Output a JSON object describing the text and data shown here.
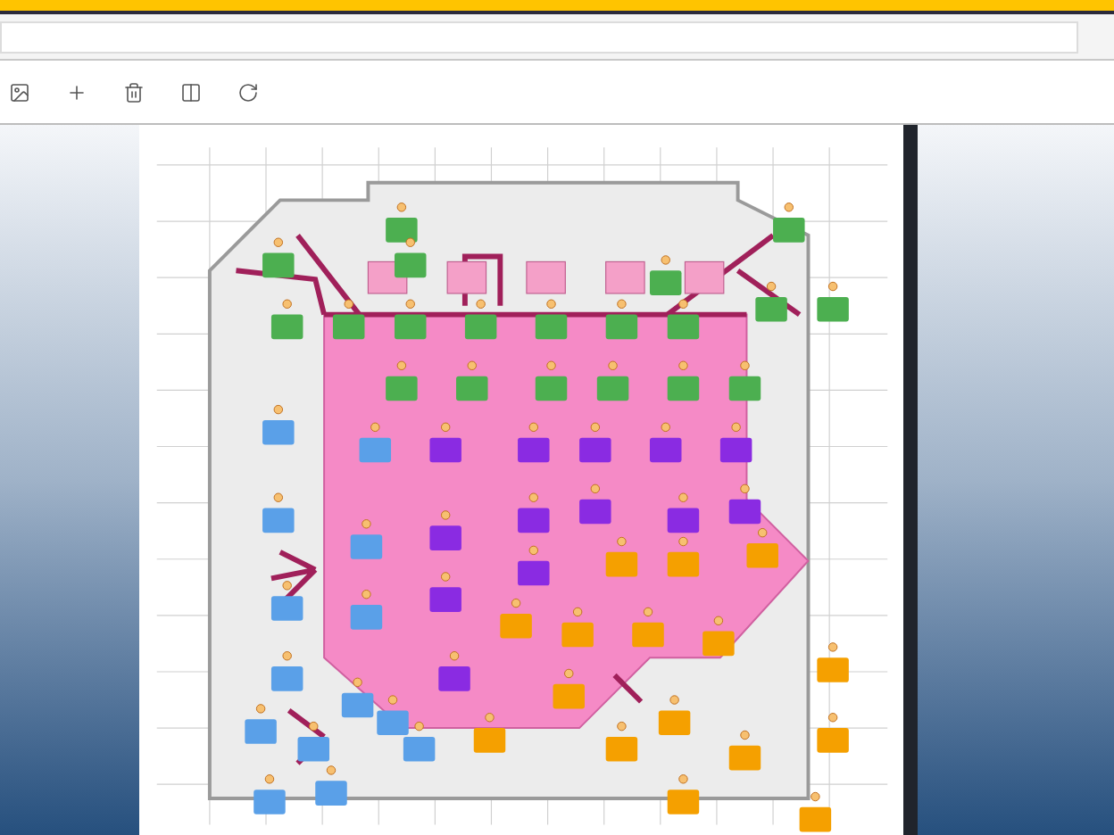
{
  "address_bar": {
    "kind": "field"
  },
  "toolbar": [
    {
      "kind": "image"
    },
    {
      "kind": "plus"
    },
    {
      "kind": "trash"
    },
    {
      "kind": "columns"
    },
    {
      "kind": "refresh"
    }
  ],
  "document": {
    "kind": "floor-plan"
  }
}
